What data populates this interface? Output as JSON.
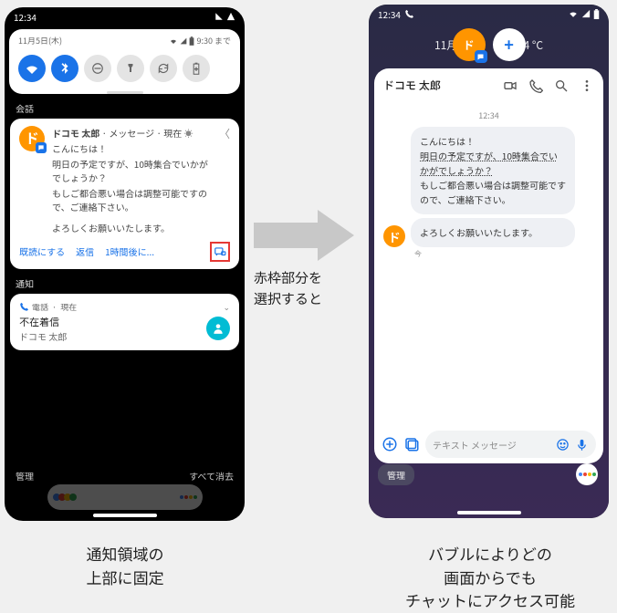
{
  "left": {
    "status_time": "12:34",
    "panel_date": "11月5日(木)",
    "panel_until": "9:30 まで",
    "section_convo": "会話",
    "notif": {
      "sender": "ドコモ 太郎",
      "app": "メッセージ",
      "when": "現在",
      "greeting": "こんにちは！",
      "line2": "明日の予定ですが、10時集合でいかがでしょうか？",
      "line3": "もしご都合悪い場合は調整可能ですので、ご連絡下さい。",
      "line4": "よろしくお願いいたします。",
      "mark_read": "既読にする",
      "reply": "返信",
      "snooze": "1時間後に..."
    },
    "section_notif": "通知",
    "call": {
      "app": "電話",
      "when": "現在",
      "title": "不在着信",
      "from": "ドコモ 太郎"
    },
    "manage": "管理",
    "clear": "すべて消去"
  },
  "right": {
    "status_time": "12:34",
    "home_date": "11月5日",
    "temp": "24 °C",
    "chat": {
      "name": "ドコモ 太郎",
      "time": "12:34",
      "msg1": "こんにちは！",
      "msg2": "明日の予定ですが、10時集合でいかがでしょうか？",
      "msg3": "もしご都合悪い場合は調整可能ですので、ご連絡下さい。",
      "msg4": "よろしくお願いいたします。",
      "ts": "今",
      "placeholder": "テキスト メッセージ"
    },
    "manage": "管理"
  },
  "middle": {
    "l1": "赤枠部分を",
    "l2": "選択すると"
  },
  "captions": {
    "left1": "通知領域の",
    "left2": "上部に固定",
    "right1": "バブルによりどの",
    "right2": "画面からでも",
    "right3": "チャットにアクセス可能"
  }
}
